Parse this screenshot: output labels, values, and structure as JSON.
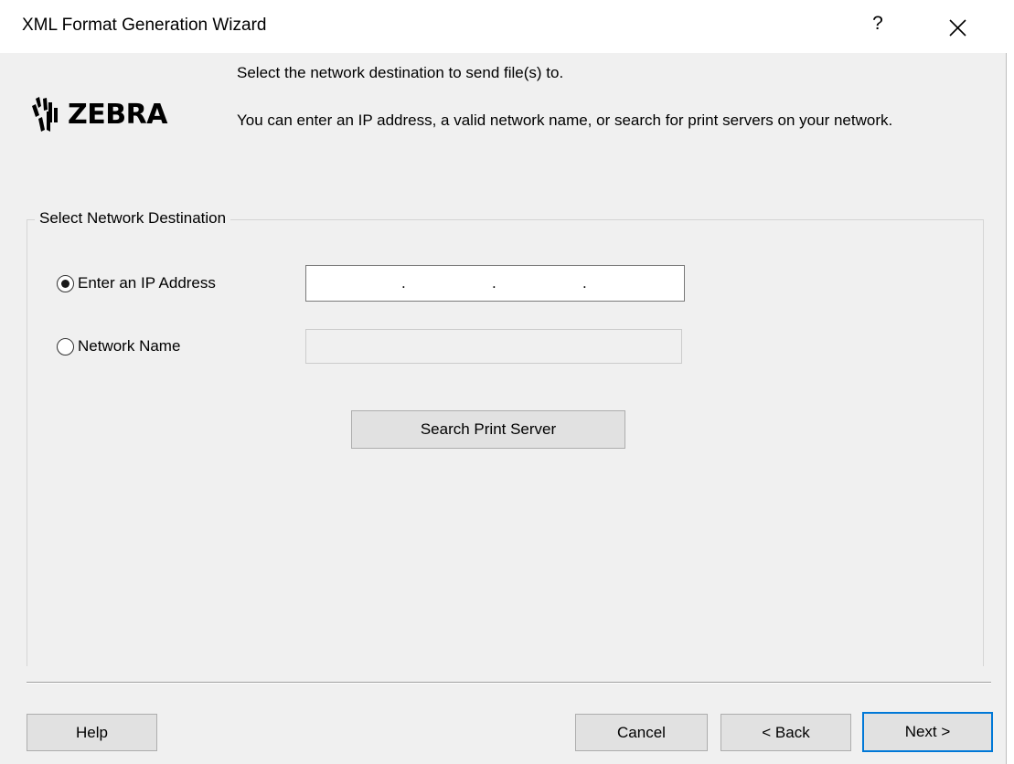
{
  "window": {
    "title": "XML Format Generation Wizard",
    "help_glyph": "?",
    "close_icon": "close-icon"
  },
  "header": {
    "logo_text": "ZEBRA",
    "logo_icon": "zebra-head-icon",
    "instruction": "Select the network destination to send file(s) to.",
    "detail": "You can enter an IP address, a valid network name, or search for print servers on your network."
  },
  "destination": {
    "group_label": "Select Network Destination",
    "ip_option_label": "Enter an IP Address",
    "ip_option_selected": true,
    "ip_separators": [
      ".",
      ".",
      "."
    ],
    "name_option_label": "Network Name",
    "name_option_selected": false,
    "name_value": "",
    "search_button_label": "Search Print Server"
  },
  "footer": {
    "help_label": "Help",
    "cancel_label": "Cancel",
    "back_label": "< Back",
    "next_label": "Next >"
  },
  "colors": {
    "dialog_background": "#f0f0f0",
    "default_button_border": "#0078d7",
    "button_face": "#e1e1e1"
  }
}
